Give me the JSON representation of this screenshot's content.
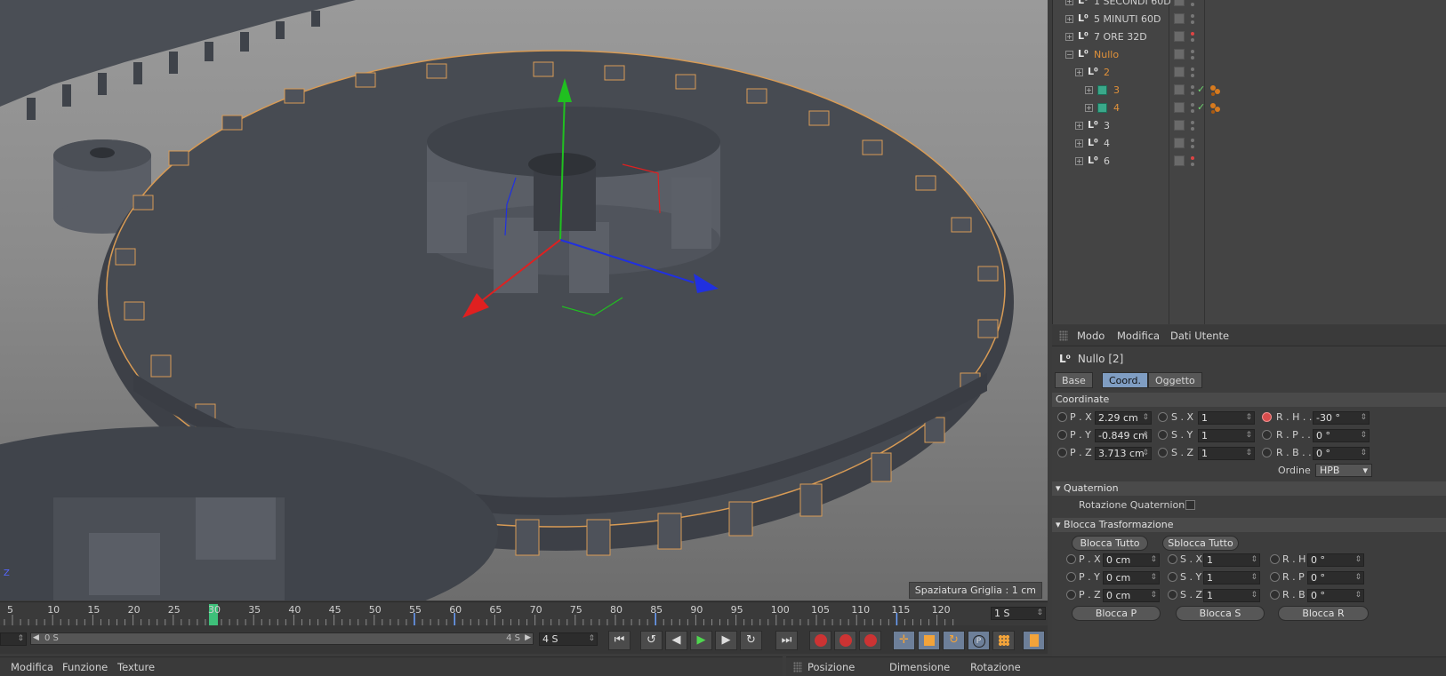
{
  "object_manager": {
    "rows": [
      {
        "name": "1 SECONDI 60D",
        "selected": false,
        "icon": "null-icon",
        "indent": 0,
        "red_dot": false
      },
      {
        "name": "5 MINUTI 60D",
        "selected": false,
        "icon": "null-icon",
        "indent": 0,
        "red_dot": false
      },
      {
        "name": "7 ORE 32D",
        "selected": false,
        "icon": "null-icon",
        "indent": 0,
        "red_dot": true
      },
      {
        "name": "Nullo",
        "selected": true,
        "icon": "null-icon",
        "indent": 0,
        "red_dot": false
      },
      {
        "name": "2",
        "selected": true,
        "icon": "null-icon",
        "indent": 1,
        "red_dot": false
      },
      {
        "name": "3",
        "selected": true,
        "icon": "cube-icon",
        "indent": 2,
        "red_dot": false,
        "check": true
      },
      {
        "name": "4",
        "selected": true,
        "icon": "cube-icon",
        "indent": 2,
        "red_dot": false,
        "check": true
      },
      {
        "name": "3",
        "selected": false,
        "icon": "null-icon",
        "indent": 1,
        "red_dot": false
      },
      {
        "name": "4",
        "selected": false,
        "icon": "null-icon",
        "indent": 1,
        "red_dot": false
      },
      {
        "name": "6",
        "selected": false,
        "icon": "null-icon",
        "indent": 1,
        "red_dot": true
      }
    ]
  },
  "attr": {
    "menu": [
      "Modo",
      "Modifica",
      "Dati Utente"
    ],
    "object_name": "Nullo [2]",
    "tabs": [
      "Base",
      "Coord.",
      "Oggetto"
    ],
    "active_tab": "Coord.",
    "section_coordinate": "Coordinate",
    "pos": {
      "px_label": "P . X",
      "px": "2.29 cm",
      "py_label": "P . Y",
      "py": "-0.849 cm",
      "pz_label": "P . Z",
      "pz": "3.713 cm"
    },
    "scale": {
      "sx_label": "S . X",
      "sx": "1",
      "sy_label": "S . Y",
      "sy": "1",
      "sz_label": "S . Z",
      "sz": "1"
    },
    "rot": {
      "rh_label": "R . H . .",
      "rh": "-30 °",
      "rp_label": "R . P . .",
      "rp": "0 °",
      "rb_label": "R . B . .",
      "rb": "0 °"
    },
    "order_label": "Ordine",
    "order_value": "HPB",
    "section_quaternion": "Quaternion",
    "quaternion_label": "Rotazione Quaternion",
    "section_lock": "Blocca Trasformazione",
    "lock_all": "Blocca Tutto",
    "unlock_all": "Sblocca Tutto",
    "lock": {
      "px_label": "P . X",
      "px": "0 cm",
      "py_label": "P . Y",
      "py": "0 cm",
      "pz_label": "P . Z",
      "pz": "0 cm",
      "sx_label": "S . X",
      "sx": "1",
      "sy_label": "S . Y",
      "sy": "1",
      "sz_label": "S . Z",
      "sz": "1",
      "rh_label": "R . H",
      "rh": "0 °",
      "rp_label": "R . P",
      "rp": "0 °",
      "rb_label": "R . B",
      "rb": "0 °"
    },
    "lock_p": "Blocca P",
    "lock_s": "Blocca S",
    "lock_r": "Blocca R"
  },
  "viewport": {
    "grid_spacing": "Spaziatura Griglia : 1 cm",
    "corner_label": "Z",
    "colors": {
      "x_axis": "#e02020",
      "y_axis": "#20c020",
      "z_axis": "#2030e0",
      "gear": "#474b52",
      "outline": "#d89b55"
    }
  },
  "timeline": {
    "ticks": [
      5,
      10,
      15,
      20,
      25,
      30,
      35,
      40,
      45,
      50,
      55,
      60,
      65,
      70,
      75,
      80,
      85,
      90,
      95,
      100,
      105,
      110,
      115,
      120
    ],
    "current_frame": 30,
    "end_field": "1 S",
    "range_start": "0 S",
    "range_end": "4 S",
    "range_field": "4 S",
    "range_arrow_left": "◀",
    "range_arrow_right": "▶"
  },
  "transport": {
    "first": "⏮",
    "prev_key": "↺",
    "prev_frame": "◀",
    "play": "▶",
    "next_frame": "▶",
    "next_key": "↻",
    "last": "⏭"
  },
  "bottom_left_menu": [
    "Modifica",
    "Funzione",
    "Texture"
  ],
  "bottom_right_menu": [
    "Posizione",
    "Dimensione",
    "Rotazione"
  ]
}
